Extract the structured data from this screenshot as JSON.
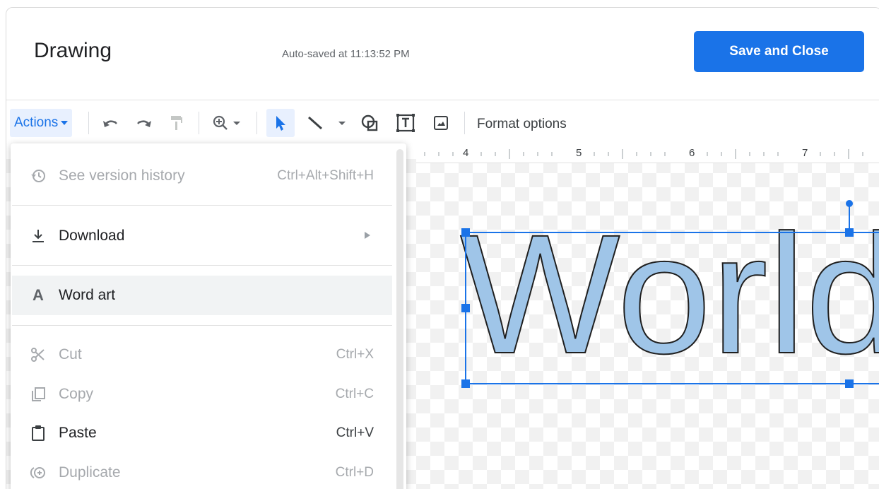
{
  "header": {
    "title": "Drawing",
    "autosave": "Auto-saved at 11:13:52 PM",
    "save_close": "Save and Close"
  },
  "toolbar": {
    "actions": "Actions",
    "format_options": "Format options",
    "icons": [
      "undo-icon",
      "redo-icon",
      "paint-format-icon",
      "zoom-icon",
      "select-icon",
      "line-icon",
      "shape-icon",
      "text-box-icon",
      "image-icon"
    ]
  },
  "ruler": {
    "marks": [
      "4",
      "5",
      "6",
      "7"
    ]
  },
  "canvas": {
    "word_art_text": "World"
  },
  "menu": {
    "items": [
      {
        "label": "See version history",
        "shortcut": "Ctrl+Alt+Shift+H",
        "icon": "history-icon",
        "enabled": false
      },
      {
        "label": "Download",
        "shortcut": "",
        "icon": "download-icon",
        "enabled": true,
        "submenu": true
      },
      {
        "label": "Word art",
        "shortcut": "",
        "icon": "word-art-icon",
        "enabled": true
      },
      {
        "label": "Cut",
        "shortcut": "Ctrl+X",
        "icon": "cut-icon",
        "enabled": false
      },
      {
        "label": "Copy",
        "shortcut": "Ctrl+C",
        "icon": "copy-icon",
        "enabled": false
      },
      {
        "label": "Paste",
        "shortcut": "Ctrl+V",
        "icon": "paste-icon",
        "enabled": true
      },
      {
        "label": "Duplicate",
        "shortcut": "Ctrl+D",
        "icon": "duplicate-icon",
        "enabled": false
      }
    ]
  },
  "colors": {
    "accent": "#1a73e8",
    "word_art_fill": "#9fc5e8",
    "disabled_text": "#a6a9ad"
  }
}
